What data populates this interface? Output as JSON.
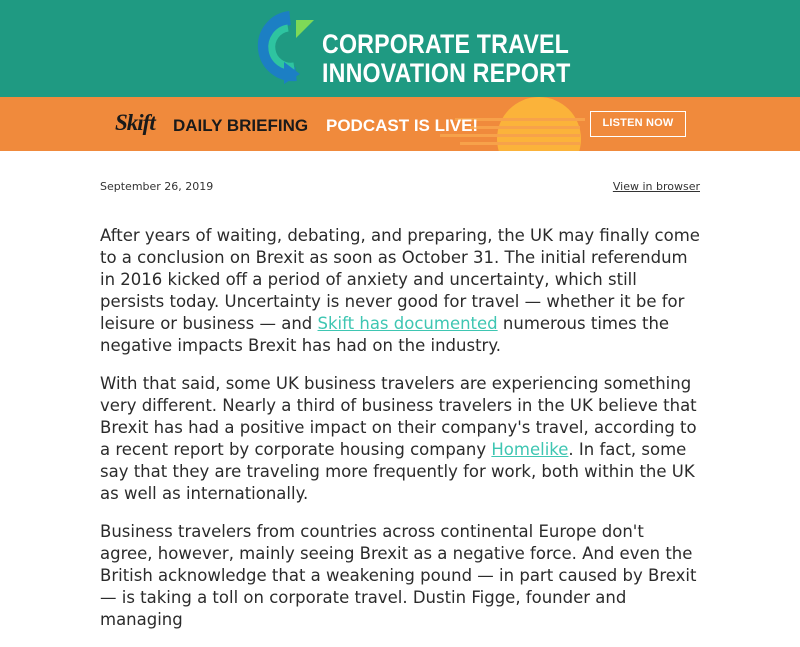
{
  "header": {
    "line1": "CORPORATE TRAVEL",
    "line2": "INNOVATION REPORT",
    "bg_color": "#1f9a82",
    "logo_icon": "c-logo-icon"
  },
  "banner": {
    "brand": "Skift",
    "daily_briefing": "DAILY BRIEFING",
    "podcast_live": "PODCAST IS LIVE!",
    "listen_now": "LISTEN NOW",
    "bg_color": "#f08a3c"
  },
  "meta": {
    "date": "September 26, 2019",
    "view_in_browser": "View in browser"
  },
  "article": {
    "p1_before": "After years of waiting, debating, and preparing, the UK may finally come to a conclusion on Brexit as soon as October 31. The initial referendum in 2016 kicked off a period of anxiety and uncertainty, which still persists today. Uncertainty is never good for travel — whether it be for leisure or business — and ",
    "p1_link": "Skift has documented",
    "p1_after": " numerous times the negative impacts Brexit has had on the industry.",
    "p2_before": "With that said, some UK business travelers are experiencing something very different. Nearly a third of business travelers in the UK believe that Brexit has had a positive impact on their company's travel, according to a recent report by corporate housing company ",
    "p2_link": "Homelike",
    "p2_after": ". In fact, some say that they are traveling more frequently for work, both within the UK as well as internationally.",
    "p3": "Business travelers from countries across continental Europe don't agree, however, mainly seeing Brexit as a negative force. And even the British acknowledge that a weakening pound — in part caused by Brexit — is taking a toll on corporate travel. Dustin Figge, founder and managing",
    "link_color": "#3ec6b2"
  }
}
